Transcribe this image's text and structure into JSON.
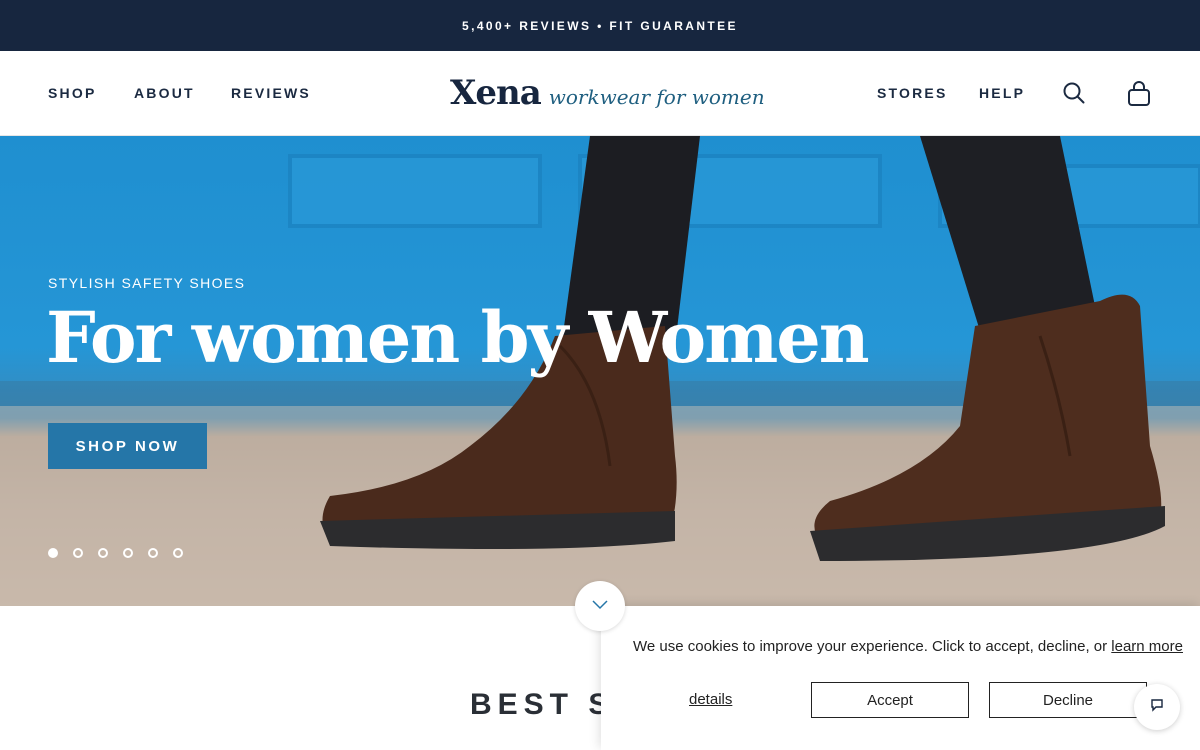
{
  "announcement": {
    "text": "5,400+ REVIEWS • FIT GUARANTEE"
  },
  "header": {
    "nav_left": [
      "SHOP",
      "ABOUT",
      "REVIEWS"
    ],
    "nav_right": [
      "STORES",
      "HELP"
    ],
    "logo": {
      "word": "Xena",
      "tagline": "workwear for women"
    },
    "icons": [
      "search-icon",
      "shopping-bag-icon"
    ]
  },
  "hero": {
    "kicker": "STYLISH SAFETY SHOES",
    "title": "For women by Women",
    "cta_label": "SHOP NOW",
    "slides_count": 6,
    "active_slide": 1
  },
  "section": {
    "heading": "BEST SELLERS"
  },
  "cookie_banner": {
    "message": "We use cookies to improve your experience. Click to accept, decline, or ",
    "learn_more": "learn more",
    "details": "details",
    "accept": "Accept",
    "decline": "Decline"
  },
  "colors": {
    "navy": "#17263f",
    "accent_blue": "#2576a8",
    "hero_blue": "#1f8fd0"
  }
}
